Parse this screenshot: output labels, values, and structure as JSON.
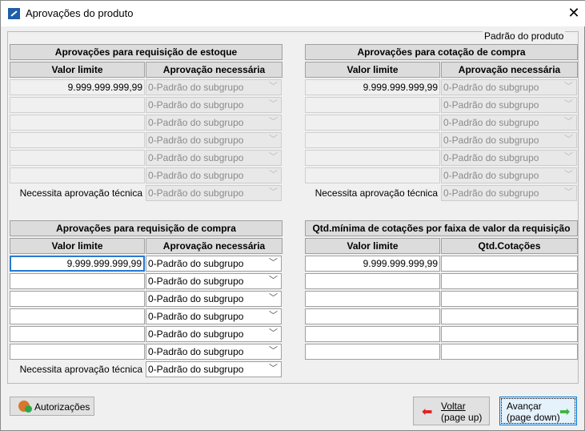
{
  "window": {
    "title": "Aprovações do produto"
  },
  "group_label": "Padrão do produto",
  "panels": [
    {
      "id": "estoque",
      "title": "Aprovações para requisição de estoque",
      "col1": "Valor limite",
      "col2": "Aprovação necessária",
      "enabled": false,
      "type": "combo",
      "rows": [
        {
          "value": "9.999.999.999,99",
          "approval": "0-Padrão do subgrupo"
        },
        {
          "value": "",
          "approval": "0-Padrão do subgrupo"
        },
        {
          "value": "",
          "approval": "0-Padrão do subgrupo"
        },
        {
          "value": "",
          "approval": "0-Padrão do subgrupo"
        },
        {
          "value": "",
          "approval": "0-Padrão do subgrupo"
        },
        {
          "value": "",
          "approval": "0-Padrão do subgrupo"
        }
      ],
      "tech_label": "Necessita aprovação técnica",
      "tech_value": "0-Padrão do subgrupo"
    },
    {
      "id": "cotacao",
      "title": "Aprovações para cotação de compra",
      "col1": "Valor limite",
      "col2": "Aprovação necessária",
      "enabled": false,
      "type": "combo",
      "rows": [
        {
          "value": "9.999.999.999,99",
          "approval": "0-Padrão do subgrupo"
        },
        {
          "value": "",
          "approval": "0-Padrão do subgrupo"
        },
        {
          "value": "",
          "approval": "0-Padrão do subgrupo"
        },
        {
          "value": "",
          "approval": "0-Padrão do subgrupo"
        },
        {
          "value": "",
          "approval": "0-Padrão do subgrupo"
        },
        {
          "value": "",
          "approval": "0-Padrão do subgrupo"
        }
      ],
      "tech_label": "Necessita aprovação técnica",
      "tech_value": "0-Padrão do subgrupo"
    },
    {
      "id": "compra",
      "title": "Aprovações para requisição de compra",
      "col1": "Valor limite",
      "col2": "Aprovação necessária",
      "enabled": true,
      "type": "combo",
      "rows": [
        {
          "value": "9.999.999.999,99",
          "approval": "0-Padrão do subgrupo"
        },
        {
          "value": "",
          "approval": "0-Padrão do subgrupo"
        },
        {
          "value": "",
          "approval": "0-Padrão do subgrupo"
        },
        {
          "value": "",
          "approval": "0-Padrão do subgrupo"
        },
        {
          "value": "",
          "approval": "0-Padrão do subgrupo"
        },
        {
          "value": "",
          "approval": "0-Padrão do subgrupo"
        }
      ],
      "tech_label": "Necessita aprovação técnica",
      "tech_value": "0-Padrão do subgrupo"
    },
    {
      "id": "cotacoes",
      "title": "Qtd.mínima de cotações por faixa de valor da requisição",
      "col1": "Valor limite",
      "col2": "Qtd.Cotações",
      "enabled": true,
      "type": "text",
      "rows": [
        {
          "value": "9.999.999.999,99",
          "approval": ""
        },
        {
          "value": "",
          "approval": ""
        },
        {
          "value": "",
          "approval": ""
        },
        {
          "value": "",
          "approval": ""
        },
        {
          "value": "",
          "approval": ""
        },
        {
          "value": "",
          "approval": ""
        }
      ]
    }
  ],
  "buttons": {
    "authorizations": "Autorizações",
    "back_line1": "Voltar",
    "back_line2": "(page up)",
    "next_line1": "Avançar",
    "next_line2": "(page down)"
  }
}
